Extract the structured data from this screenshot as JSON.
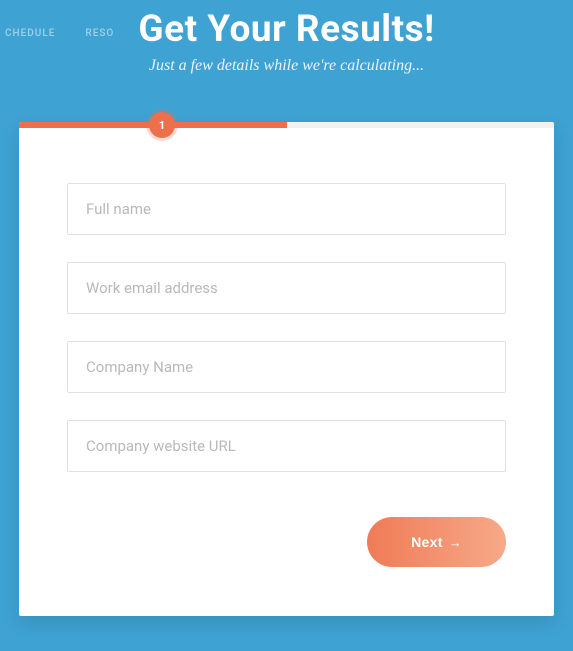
{
  "bg_nav": {
    "item1": "CHEDULE",
    "item2": "RESO"
  },
  "header": {
    "title": "Get Your Results!",
    "subtitle": "Just a few details while we're calculating..."
  },
  "progress": {
    "step": "1"
  },
  "form": {
    "full_name": {
      "placeholder": "Full name",
      "value": ""
    },
    "email": {
      "placeholder": "Work email address",
      "value": ""
    },
    "company": {
      "placeholder": "Company Name",
      "value": ""
    },
    "website": {
      "placeholder": "Company website URL",
      "value": ""
    }
  },
  "actions": {
    "next_label": "Next",
    "arrow": "→"
  }
}
